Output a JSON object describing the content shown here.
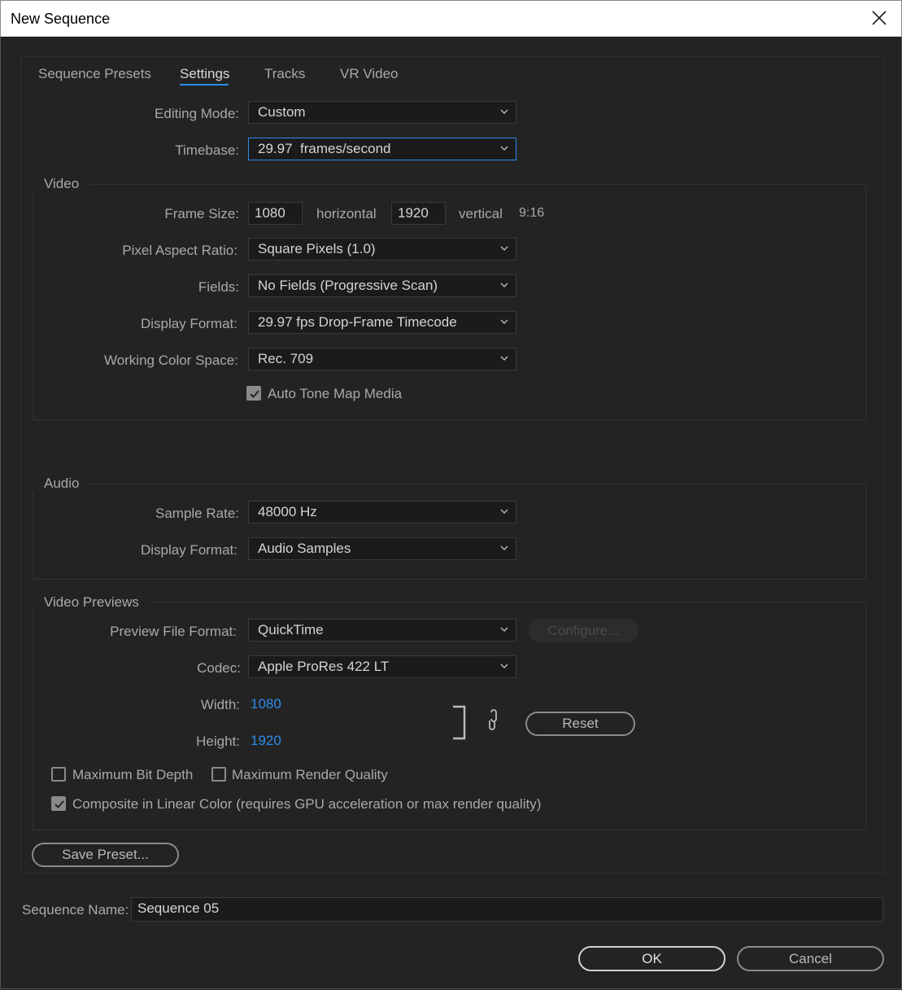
{
  "window": {
    "title": "New Sequence"
  },
  "tabs": [
    {
      "label": "Sequence Presets"
    },
    {
      "label": "Settings"
    },
    {
      "label": "Tracks"
    },
    {
      "label": "VR Video"
    }
  ],
  "general": {
    "editing_mode_label": "Editing Mode:",
    "editing_mode_value": "Custom",
    "timebase_label": "Timebase:",
    "timebase_value": "29.97  frames/second"
  },
  "video": {
    "title": "Video",
    "frame_size_label": "Frame Size:",
    "frame_width": "1080",
    "horizontal_label": "horizontal",
    "frame_height": "1920",
    "vertical_label": "vertical",
    "aspect": "9:16",
    "par_label": "Pixel Aspect Ratio:",
    "par_value": "Square Pixels (1.0)",
    "fields_label": "Fields:",
    "fields_value": "No Fields (Progressive Scan)",
    "display_format_label": "Display Format:",
    "display_format_value": "29.97 fps Drop-Frame Timecode",
    "color_space_label": "Working Color Space:",
    "color_space_value": "Rec. 709",
    "auto_tone_label": "Auto Tone Map Media",
    "auto_tone_checked": true
  },
  "audio": {
    "title": "Audio",
    "sample_rate_label": "Sample Rate:",
    "sample_rate_value": "48000 Hz",
    "display_format_label": "Display Format:",
    "display_format_value": "Audio Samples"
  },
  "previews": {
    "title": "Video Previews",
    "file_format_label": "Preview File Format:",
    "file_format_value": "QuickTime",
    "configure_label": "Configure...",
    "codec_label": "Codec:",
    "codec_value": "Apple ProRes 422 LT",
    "width_label": "Width:",
    "width_value": "1080",
    "height_label": "Height:",
    "height_value": "1920",
    "reset_label": "Reset",
    "max_bit_depth_label": "Maximum Bit Depth",
    "max_bit_depth_checked": false,
    "max_render_quality_label": "Maximum Render Quality",
    "max_render_quality_checked": false,
    "composite_linear_label": "Composite in Linear Color (requires GPU acceleration or max render quality)",
    "composite_linear_checked": true
  },
  "save_preset_label": "Save Preset...",
  "sequence_name_label": "Sequence Name:",
  "sequence_name_value": "Sequence 05",
  "ok_label": "OK",
  "cancel_label": "Cancel",
  "colors": {
    "accent": "#2d8ceb",
    "background": "#232323",
    "field": "#1b1b1b"
  }
}
